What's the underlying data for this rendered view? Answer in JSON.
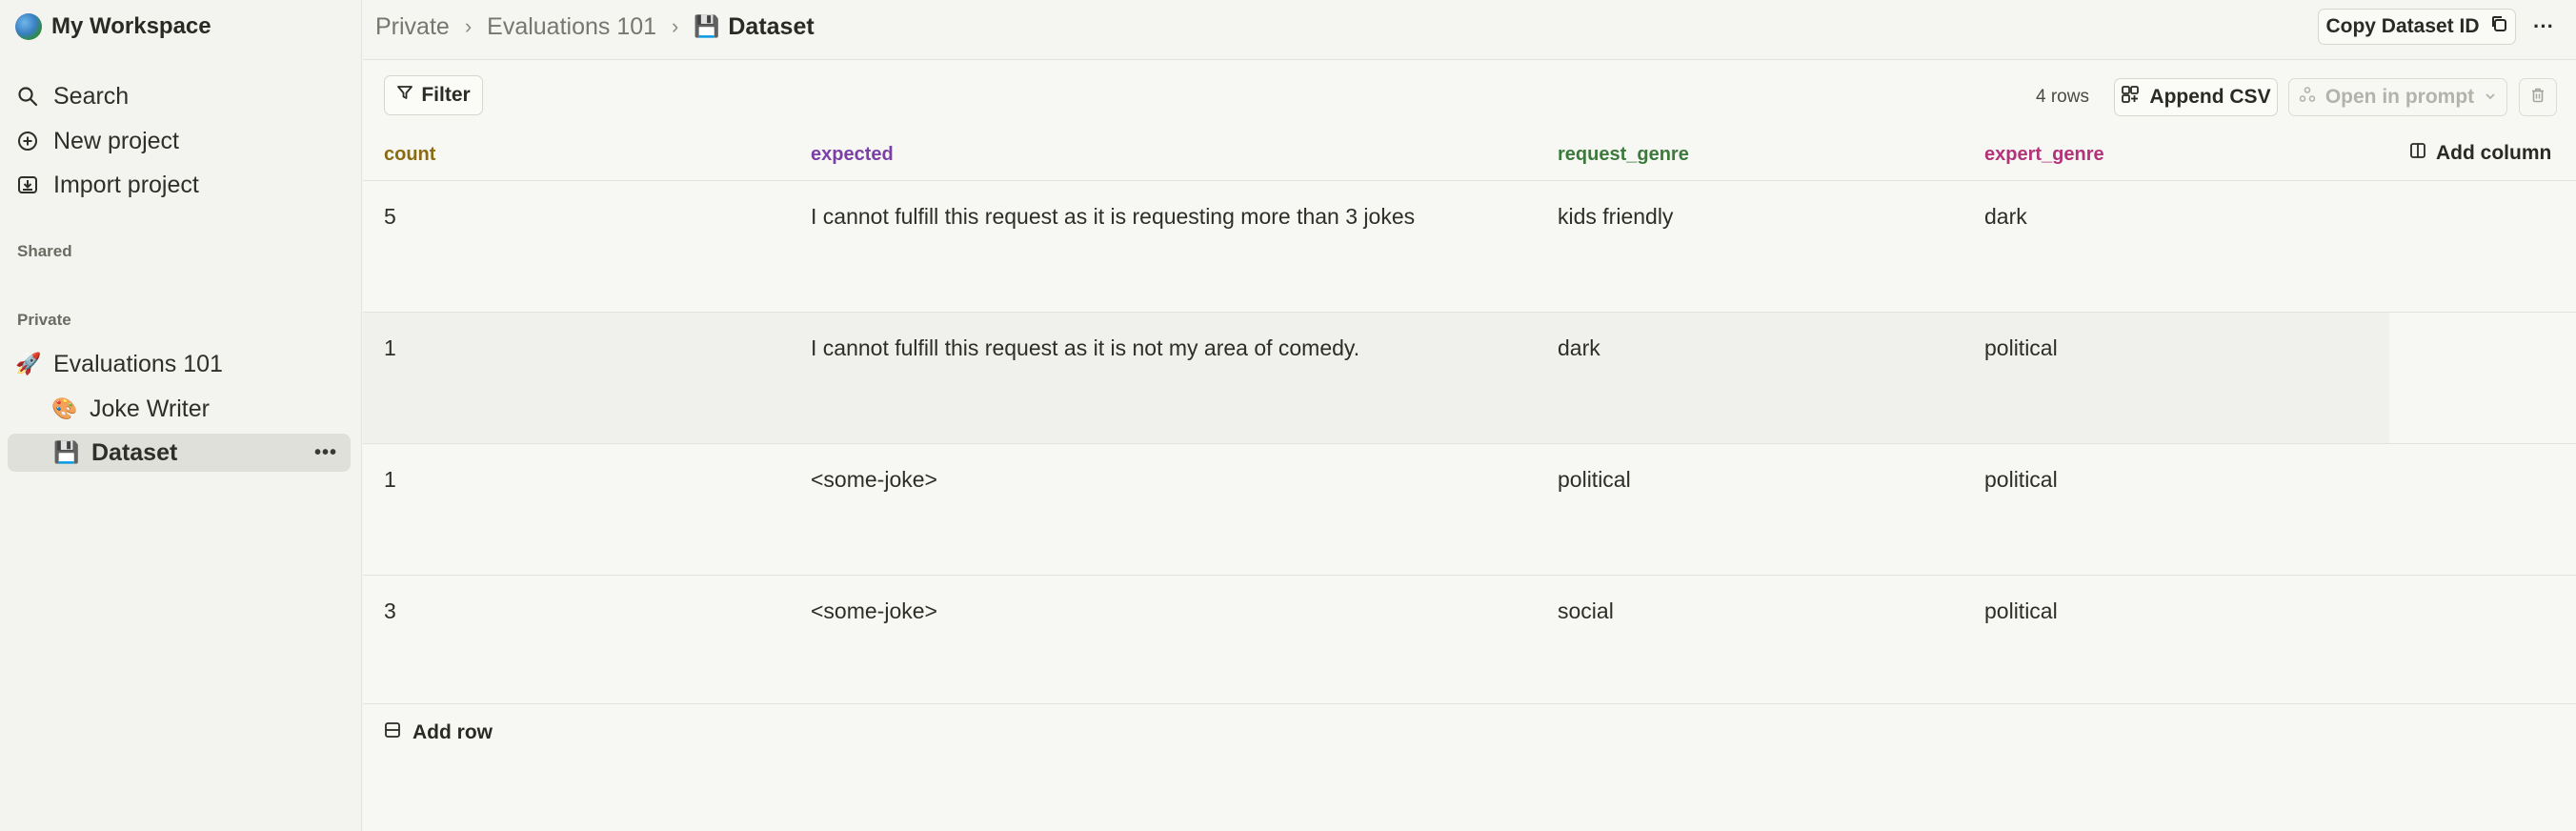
{
  "sidebar": {
    "workspace_name": "My Workspace",
    "nav": [
      {
        "label": "Search",
        "icon": "search-icon"
      },
      {
        "label": "New project",
        "icon": "plus-circle-icon"
      },
      {
        "label": "Import project",
        "icon": "import-icon"
      }
    ],
    "shared_label": "Shared",
    "private_label": "Private",
    "projects": [
      {
        "label": "Evaluations 101",
        "icon": "rocket-icon"
      },
      {
        "label": "Joke Writer",
        "icon": "palette-icon"
      },
      {
        "label": "Dataset",
        "icon": "floppy-disk-icon",
        "active": true
      }
    ]
  },
  "breadcrumb": {
    "items": [
      "Private",
      "Evaluations 101"
    ],
    "current": "Dataset"
  },
  "header": {
    "copy_id_label": "Copy Dataset ID"
  },
  "toolbar": {
    "filter_label": "Filter",
    "row_count": "4 rows",
    "append_csv_label": "Append CSV",
    "open_prompt_label": "Open in prompt"
  },
  "table": {
    "columns": [
      {
        "label": "count",
        "color": "#8a6a12"
      },
      {
        "label": "expected",
        "color": "#7b3fa6"
      },
      {
        "label": "request_genre",
        "color": "#3c7a3c"
      },
      {
        "label": "expert_genre",
        "color": "#b3337a"
      }
    ],
    "add_column_label": "Add column",
    "rows": [
      [
        "5",
        "I cannot fulfill this request as it is requesting more than 3 jokes",
        "kids friendly",
        "dark"
      ],
      [
        "1",
        "I cannot fulfill this request as it is not my area of comedy.",
        "dark",
        "political"
      ],
      [
        "1",
        "<some-joke>",
        "political",
        "political"
      ],
      [
        "3",
        "<some-joke>",
        "social",
        "political"
      ]
    ],
    "add_row_label": "Add row"
  }
}
